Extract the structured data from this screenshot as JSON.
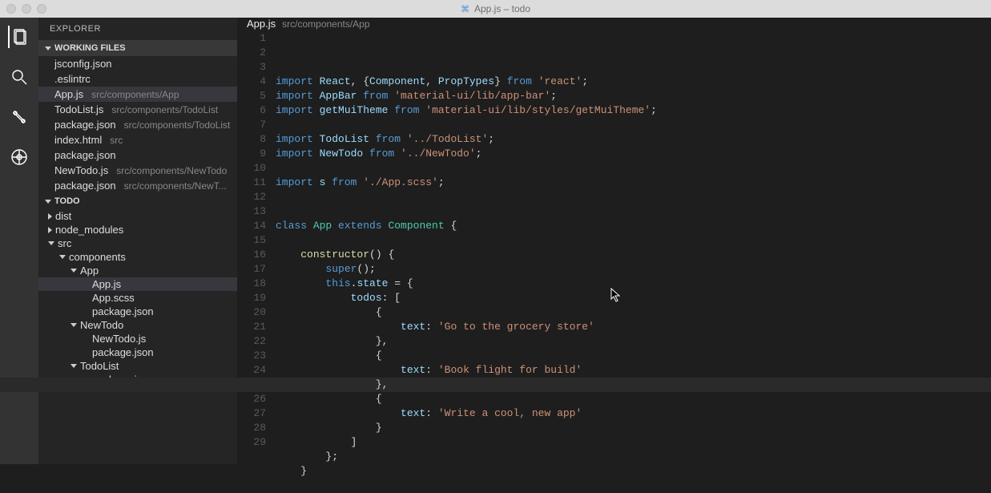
{
  "window": {
    "title": "App.js – todo"
  },
  "activity": {
    "active": "explorer"
  },
  "sidebar": {
    "title": "EXPLORER",
    "working_files": {
      "label": "WORKING FILES",
      "items": [
        {
          "name": "jsconfig.json",
          "hint": ""
        },
        {
          "name": ".eslintrc",
          "hint": ""
        },
        {
          "name": "App.js",
          "hint": "src/components/App",
          "selected": true
        },
        {
          "name": "TodoList.js",
          "hint": "src/components/TodoList"
        },
        {
          "name": "package.json",
          "hint": "src/components/TodoList"
        },
        {
          "name": "index.html",
          "hint": "src"
        },
        {
          "name": "package.json",
          "hint": ""
        },
        {
          "name": "NewTodo.js",
          "hint": "src/components/NewTodo"
        },
        {
          "name": "package.json",
          "hint": "src/components/NewT..."
        }
      ]
    },
    "project": {
      "label": "TODO",
      "tree": [
        {
          "indent": 0,
          "kind": "collapsed",
          "label": "dist"
        },
        {
          "indent": 0,
          "kind": "collapsed",
          "label": "node_modules"
        },
        {
          "indent": 0,
          "kind": "expanded",
          "label": "src"
        },
        {
          "indent": 1,
          "kind": "expanded",
          "label": "components"
        },
        {
          "indent": 2,
          "kind": "expanded",
          "label": "App"
        },
        {
          "indent": 3,
          "kind": "file",
          "label": "App.js",
          "selected": true
        },
        {
          "indent": 3,
          "kind": "file",
          "label": "App.scss"
        },
        {
          "indent": 3,
          "kind": "file",
          "label": "package.json"
        },
        {
          "indent": 2,
          "kind": "expanded",
          "label": "NewTodo"
        },
        {
          "indent": 3,
          "kind": "file",
          "label": "NewTodo.js"
        },
        {
          "indent": 3,
          "kind": "file",
          "label": "package.json"
        },
        {
          "indent": 2,
          "kind": "expanded",
          "label": "TodoList"
        },
        {
          "indent": 3,
          "kind": "file",
          "label": "package.json"
        }
      ]
    }
  },
  "editor": {
    "tab": {
      "name": "App.js",
      "hint": "src/components/App"
    },
    "lines": [
      [
        [
          "key",
          "import "
        ],
        [
          "id",
          "React"
        ],
        [
          "pun",
          ", {"
        ],
        [
          "id",
          "Component"
        ],
        [
          "pun",
          ", "
        ],
        [
          "id",
          "PropTypes"
        ],
        [
          "pun",
          "} "
        ],
        [
          "key",
          "from "
        ],
        [
          "str",
          "'react'"
        ],
        [
          "pun",
          ";"
        ]
      ],
      [
        [
          "key",
          "import "
        ],
        [
          "id",
          "AppBar"
        ],
        [
          "pun",
          " "
        ],
        [
          "key",
          "from "
        ],
        [
          "str",
          "'material-ui/lib/app-bar'"
        ],
        [
          "pun",
          ";"
        ]
      ],
      [
        [
          "key",
          "import "
        ],
        [
          "id",
          "getMuiTheme"
        ],
        [
          "pun",
          " "
        ],
        [
          "key",
          "from "
        ],
        [
          "str",
          "'material-ui/lib/styles/getMuiTheme'"
        ],
        [
          "pun",
          ";"
        ]
      ],
      [],
      [
        [
          "key",
          "import "
        ],
        [
          "id",
          "TodoList"
        ],
        [
          "pun",
          " "
        ],
        [
          "key",
          "from "
        ],
        [
          "str",
          "'../TodoList'"
        ],
        [
          "pun",
          ";"
        ]
      ],
      [
        [
          "key",
          "import "
        ],
        [
          "id",
          "NewTodo"
        ],
        [
          "pun",
          " "
        ],
        [
          "key",
          "from "
        ],
        [
          "str",
          "'../NewTodo'"
        ],
        [
          "pun",
          ";"
        ]
      ],
      [],
      [
        [
          "key",
          "import "
        ],
        [
          "id",
          "s"
        ],
        [
          "pun",
          " "
        ],
        [
          "key",
          "from "
        ],
        [
          "str",
          "'./App.scss'"
        ],
        [
          "pun",
          ";"
        ]
      ],
      [],
      [],
      [
        [
          "key",
          "class "
        ],
        [
          "type",
          "App"
        ],
        [
          "pun",
          " "
        ],
        [
          "key",
          "extends "
        ],
        [
          "type",
          "Component"
        ],
        [
          "pun",
          " {"
        ]
      ],
      [],
      [
        [
          "pun",
          "    "
        ],
        [
          "fn",
          "constructor"
        ],
        [
          "pun",
          "() {"
        ]
      ],
      [
        [
          "pun",
          "        "
        ],
        [
          "key",
          "super"
        ],
        [
          "pun",
          "();"
        ]
      ],
      [
        [
          "pun",
          "        "
        ],
        [
          "this",
          "this"
        ],
        [
          "pun",
          "."
        ],
        [
          "id",
          "state"
        ],
        [
          "pun",
          " = {"
        ]
      ],
      [
        [
          "pun",
          "            "
        ],
        [
          "id",
          "todos"
        ],
        [
          "pun",
          ": ["
        ]
      ],
      [
        [
          "pun",
          "                {"
        ]
      ],
      [
        [
          "pun",
          "                    "
        ],
        [
          "id",
          "text"
        ],
        [
          "pun",
          ": "
        ],
        [
          "str",
          "'Go to the grocery store'"
        ]
      ],
      [
        [
          "pun",
          "                },"
        ]
      ],
      [
        [
          "pun",
          "                {"
        ]
      ],
      [
        [
          "pun",
          "                    "
        ],
        [
          "id",
          "text"
        ],
        [
          "pun",
          ": "
        ],
        [
          "str",
          "'Book flight for build'"
        ]
      ],
      [
        [
          "pun",
          "                },"
        ]
      ],
      [
        [
          "pun",
          "                {"
        ]
      ],
      [
        [
          "pun",
          "                    "
        ],
        [
          "id",
          "text"
        ],
        [
          "pun",
          ": "
        ],
        [
          "str",
          "'Write a cool, new app'"
        ]
      ],
      [
        [
          "pun",
          "                }"
        ]
      ],
      [
        [
          "pun",
          "            ]"
        ]
      ],
      [
        [
          "pun",
          "        };"
        ]
      ],
      [
        [
          "pun",
          "    }"
        ]
      ],
      []
    ],
    "highlight_line": 22
  }
}
